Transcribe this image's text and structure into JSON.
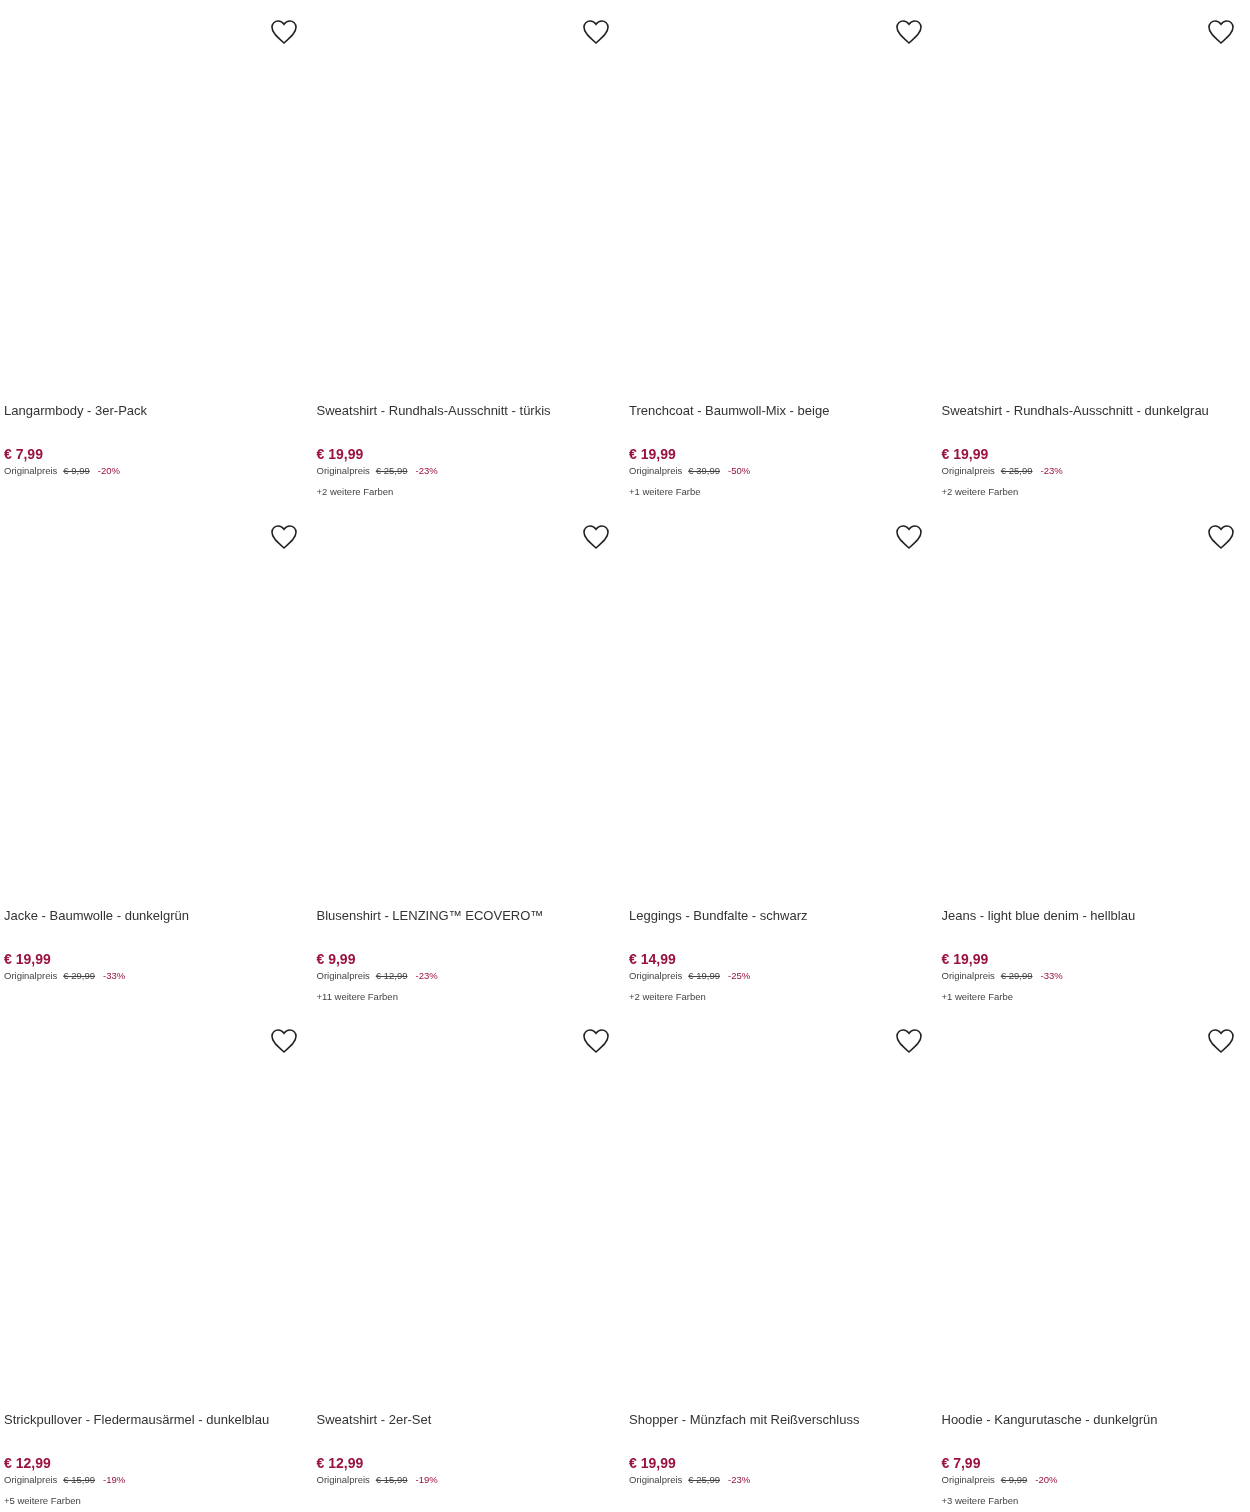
{
  "products": [
    {
      "title": "Langarmbody - 3er-Pack",
      "price": "€ 7,99",
      "original_label": "Originalpreis",
      "original_price": "€ 9,99",
      "discount": "-20%"
    },
    {
      "title": "Sweatshirt - Rundhals-Ausschnitt - türkis",
      "price": "€ 19,99",
      "original_label": "Originalpreis",
      "original_price": "€ 25,99",
      "discount": "-23%",
      "more_colors": "+2 weitere Farben"
    },
    {
      "title": "Trenchcoat - Baumwoll-Mix - beige",
      "price": "€ 19,99",
      "original_label": "Originalpreis",
      "original_price": "€ 39,99",
      "discount": "-50%",
      "more_colors": "+1 weitere Farbe"
    },
    {
      "title": "Sweatshirt - Rundhals-Ausschnitt - dunkelgrau",
      "price": "€ 19,99",
      "original_label": "Originalpreis",
      "original_price": "€ 25,99",
      "discount": "-23%",
      "more_colors": "+2 weitere Farben"
    },
    {
      "title": "Jacke - Baumwolle - dunkelgrün",
      "price": "€ 19,99",
      "original_label": "Originalpreis",
      "original_price": "€ 29,99",
      "discount": "-33%"
    },
    {
      "title": "Blusenshirt - LENZING™ ECOVERO™",
      "price": "€ 9,99",
      "original_label": "Originalpreis",
      "original_price": "€ 12,99",
      "discount": "-23%",
      "more_colors": "+11 weitere Farben"
    },
    {
      "title": "Leggings - Bundfalte - schwarz",
      "price": "€ 14,99",
      "original_label": "Originalpreis",
      "original_price": "€ 19,99",
      "discount": "-25%",
      "more_colors": "+2 weitere Farben"
    },
    {
      "title": "Jeans - light blue denim - hellblau",
      "price": "€ 19,99",
      "original_label": "Originalpreis",
      "original_price": "€ 29,99",
      "discount": "-33%",
      "more_colors": "+1 weitere Farbe"
    },
    {
      "title": "Strickpullover - Fledermausärmel - dunkelblau",
      "price": "€ 12,99",
      "original_label": "Originalpreis",
      "original_price": "€ 15,99",
      "discount": "-19%",
      "more_colors": "+5 weitere Farben"
    },
    {
      "title": "Sweatshirt - 2er-Set",
      "price": "€ 12,99",
      "original_label": "Originalpreis",
      "original_price": "€ 15,99",
      "discount": "-19%"
    },
    {
      "title": "Shopper - Münzfach mit Reißverschluss",
      "price": "€ 19,99",
      "original_label": "Originalpreis",
      "original_price": "€ 25,99",
      "discount": "-23%"
    },
    {
      "title": "Hoodie - Kangurutasche - dunkelgrün",
      "price": "€ 7,99",
      "original_label": "Originalpreis",
      "original_price": "€ 9,99",
      "discount": "-20%",
      "more_colors": "+3 weitere Farben"
    }
  ]
}
